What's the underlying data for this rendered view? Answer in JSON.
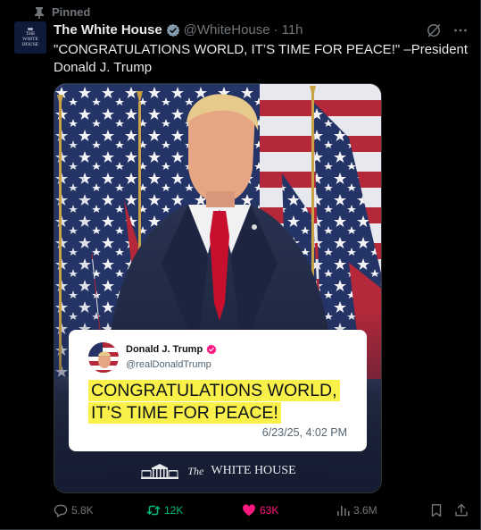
{
  "pinned": {
    "label": "Pinned"
  },
  "account": {
    "avatar_lines": [
      "THE",
      "WHITE",
      "HOUSE"
    ],
    "display_name": "The White House",
    "handle": "@WhiteHouse",
    "separator": "·",
    "time": "11h"
  },
  "tweet": {
    "text": "\"CONGRATULATIONS WORLD, IT’S TIME FOR PEACE!\" –President Donald J. Trump"
  },
  "media": {
    "quote": {
      "name": "Donald J. Trump",
      "handle": "@realDonaldTrump",
      "line1": "CONGRATULATIONS WORLD,",
      "line2": "IT’S TIME FOR PEACE!",
      "date": "6/23/25, 4:02 PM"
    },
    "footer": {
      "the": "The",
      "name": "WHITE HOUSE"
    }
  },
  "actions": {
    "replies": "5.8K",
    "reposts": "12K",
    "likes": "63K",
    "views": "3.6M"
  },
  "colors": {
    "background": "#000000",
    "accent_like": "#f91880",
    "accent_repost": "#00ba7c",
    "verified_badge": "#829aab",
    "highlight": "#f9f04a"
  }
}
